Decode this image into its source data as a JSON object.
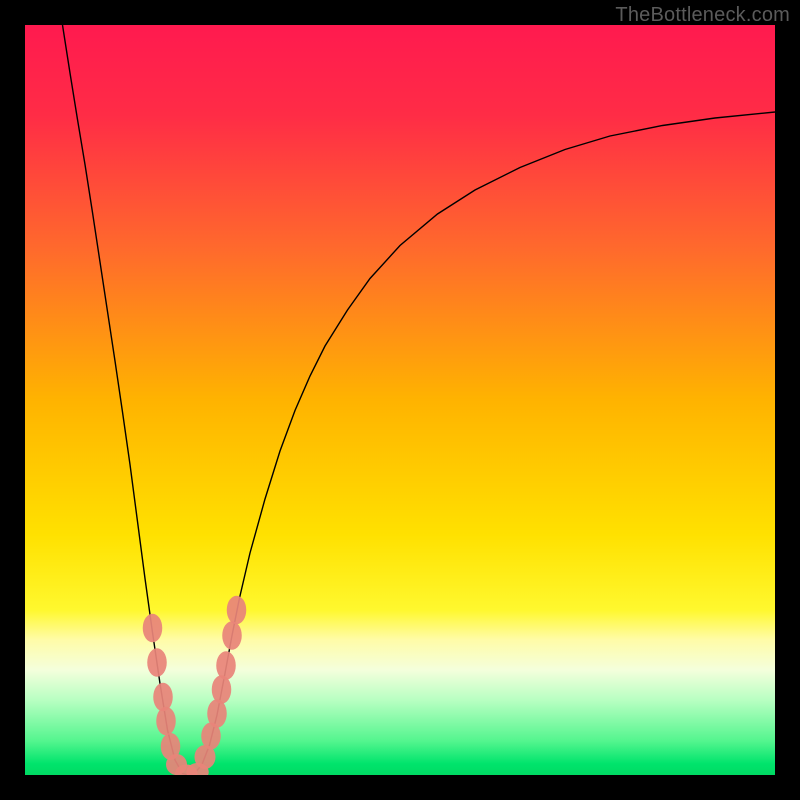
{
  "watermark": "TheBottleneck.com",
  "chart_data": {
    "type": "line",
    "title": "",
    "xlabel": "",
    "ylabel": "",
    "xlim": [
      0,
      100
    ],
    "ylim": [
      0,
      100
    ],
    "gradient_stops": [
      {
        "offset": 0.0,
        "color": "#ff1a4f"
      },
      {
        "offset": 0.12,
        "color": "#ff2c46"
      },
      {
        "offset": 0.3,
        "color": "#ff6a2c"
      },
      {
        "offset": 0.5,
        "color": "#ffb300"
      },
      {
        "offset": 0.68,
        "color": "#ffe100"
      },
      {
        "offset": 0.78,
        "color": "#fff82e"
      },
      {
        "offset": 0.82,
        "color": "#fffca8"
      },
      {
        "offset": 0.86,
        "color": "#f4ffdc"
      },
      {
        "offset": 0.9,
        "color": "#b8ffc2"
      },
      {
        "offset": 0.955,
        "color": "#53f58e"
      },
      {
        "offset": 0.985,
        "color": "#00e46c"
      },
      {
        "offset": 1.0,
        "color": "#00da63"
      }
    ],
    "series": [
      {
        "name": "bottleneck-curve",
        "stroke": "#000000",
        "points": [
          [
            5.0,
            100.0
          ],
          [
            6.0,
            93.6
          ],
          [
            7.0,
            87.4
          ],
          [
            8.0,
            81.4
          ],
          [
            9.0,
            75.0
          ],
          [
            10.0,
            68.4
          ],
          [
            11.0,
            61.8
          ],
          [
            12.0,
            55.2
          ],
          [
            13.0,
            48.4
          ],
          [
            14.0,
            41.4
          ],
          [
            15.0,
            33.8
          ],
          [
            16.0,
            26.2
          ],
          [
            17.0,
            19.0
          ],
          [
            18.0,
            12.2
          ],
          [
            19.0,
            6.0
          ],
          [
            20.0,
            2.0
          ],
          [
            21.0,
            0.2
          ],
          [
            21.8,
            0.0
          ],
          [
            22.6,
            0.2
          ],
          [
            23.6,
            1.4
          ],
          [
            24.6,
            4.0
          ],
          [
            25.6,
            8.0
          ],
          [
            26.6,
            13.2
          ],
          [
            27.6,
            18.6
          ],
          [
            28.6,
            23.6
          ],
          [
            30.0,
            29.6
          ],
          [
            32.0,
            36.8
          ],
          [
            34.0,
            43.2
          ],
          [
            36.0,
            48.6
          ],
          [
            38.0,
            53.2
          ],
          [
            40.0,
            57.2
          ],
          [
            43.0,
            62.0
          ],
          [
            46.0,
            66.2
          ],
          [
            50.0,
            70.6
          ],
          [
            55.0,
            74.8
          ],
          [
            60.0,
            78.0
          ],
          [
            66.0,
            81.0
          ],
          [
            72.0,
            83.4
          ],
          [
            78.0,
            85.2
          ],
          [
            85.0,
            86.6
          ],
          [
            92.0,
            87.6
          ],
          [
            100.0,
            88.4
          ]
        ]
      }
    ],
    "markers": [
      {
        "x": 17.0,
        "y": 19.6,
        "rx": 1.3,
        "ry": 1.9
      },
      {
        "x": 17.6,
        "y": 15.0,
        "rx": 1.3,
        "ry": 1.9
      },
      {
        "x": 18.4,
        "y": 10.4,
        "rx": 1.3,
        "ry": 1.9
      },
      {
        "x": 18.8,
        "y": 7.2,
        "rx": 1.3,
        "ry": 1.9
      },
      {
        "x": 19.4,
        "y": 3.8,
        "rx": 1.3,
        "ry": 1.8
      },
      {
        "x": 20.2,
        "y": 1.4,
        "rx": 1.4,
        "ry": 1.4
      },
      {
        "x": 21.5,
        "y": 0.2,
        "rx": 1.5,
        "ry": 1.2
      },
      {
        "x": 23.0,
        "y": 0.4,
        "rx": 1.5,
        "ry": 1.2
      },
      {
        "x": 24.0,
        "y": 2.4,
        "rx": 1.4,
        "ry": 1.6
      },
      {
        "x": 24.8,
        "y": 5.2,
        "rx": 1.3,
        "ry": 1.8
      },
      {
        "x": 25.6,
        "y": 8.2,
        "rx": 1.3,
        "ry": 1.9
      },
      {
        "x": 26.2,
        "y": 11.4,
        "rx": 1.3,
        "ry": 1.9
      },
      {
        "x": 26.8,
        "y": 14.6,
        "rx": 1.3,
        "ry": 1.9
      },
      {
        "x": 27.6,
        "y": 18.6,
        "rx": 1.3,
        "ry": 1.9
      },
      {
        "x": 28.2,
        "y": 22.0,
        "rx": 1.3,
        "ry": 1.9
      }
    ]
  }
}
